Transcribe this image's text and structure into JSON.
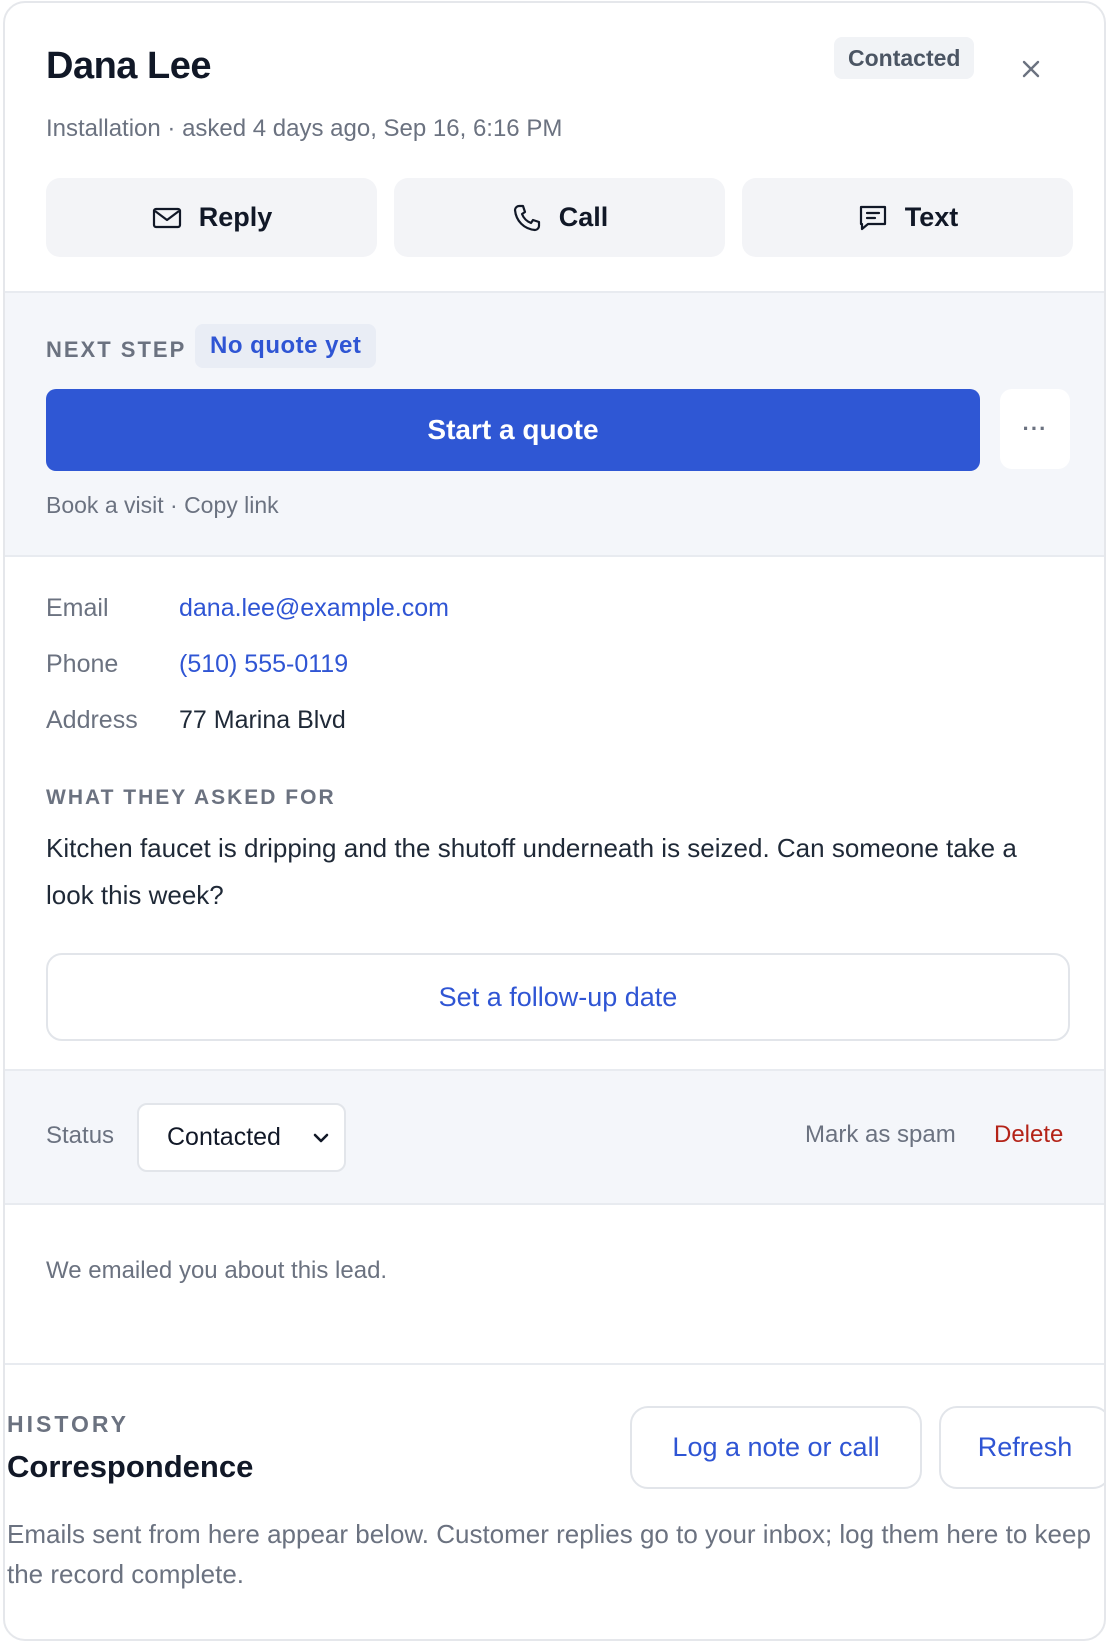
{
  "lead": {
    "name": "Dana Lee",
    "subtitle": "Installation · asked 4 days ago, Sep 16, 6:16 PM",
    "status_badge": "Contacted"
  },
  "actions": {
    "reply": "Reply",
    "call": "Call",
    "text": "Text"
  },
  "next_step": {
    "label": "NEXT STEP",
    "badge": "No quote yet",
    "primary": "Start a quote",
    "more": "···",
    "book_visit": "Book a visit",
    "separator": "·",
    "copy_link": "Copy link"
  },
  "details": {
    "fields": [
      {
        "key": "Email",
        "value": "dana.lee@example.com"
      },
      {
        "key": "Phone",
        "value": "(510) 555-0119"
      },
      {
        "key": "Address",
        "value": "77 Marina Blvd"
      }
    ],
    "request_label": "WHAT THEY ASKED FOR",
    "request_text": "Kitchen faucet is dripping and the shutoff underneath is seized. Can someone take a look this week?",
    "followup_button": "Set a follow-up date"
  },
  "status_row": {
    "label": "Status",
    "selected": "Contacted",
    "mark_spam": "Mark as spam",
    "delete": "Delete"
  },
  "notice": {
    "text": "We emailed you about this lead."
  },
  "history": {
    "label": "HISTORY",
    "title": "Correspondence",
    "log_button": "Log a note or call",
    "refresh_button": "Refresh",
    "description": "Emails sent from here appear below. Customer replies go to your inbox; log them here to keep the record complete."
  },
  "colors": {
    "accent": "#2f57d4",
    "link": "#2f55d4",
    "danger": "#b42318",
    "section_bg": "#f4f6fa"
  },
  "icons": {
    "close": "close-icon",
    "reply": "mail-icon",
    "call": "phone-icon",
    "text": "chat-icon",
    "select": "chevron-down-icon"
  }
}
